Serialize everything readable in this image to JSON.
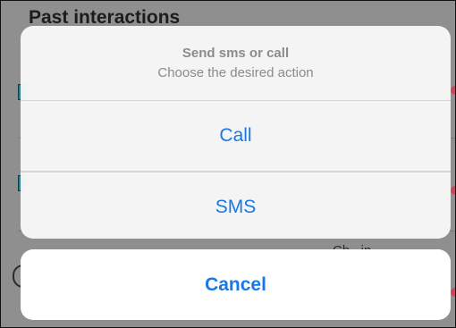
{
  "background": {
    "title": "Past interactions",
    "peek_text": "Ch...in..."
  },
  "sheet": {
    "title": "Send sms or call",
    "subtitle": "Choose the desired action",
    "actions": [
      {
        "label": "Call"
      },
      {
        "label": "SMS"
      }
    ],
    "cancel_label": "Cancel"
  },
  "colors": {
    "accent": "#1a78e5",
    "overlay": "#8f8f8f",
    "sheet_bg": "#f7f7f7"
  }
}
